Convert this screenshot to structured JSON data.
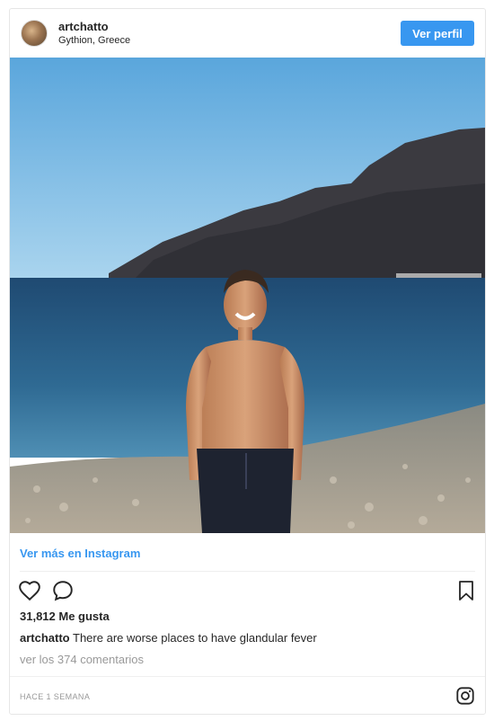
{
  "header": {
    "username": "artchatto",
    "location": "Gythion, Greece",
    "view_profile_label": "Ver perfil"
  },
  "post": {
    "image_icon": "photo-beach-shirtless-man",
    "more_link": "Ver más en Instagram",
    "likes": "31,812 Me gusta",
    "caption_user": "artchatto",
    "caption_text": "There are worse places to have glandular fever",
    "comments": "ver los 374 comentarios",
    "timestamp": "HACE 1 SEMANA"
  },
  "icons": {
    "like": "heart-icon",
    "comment": "comment-bubble-icon",
    "save": "bookmark-icon",
    "brand": "instagram-icon"
  },
  "colors": {
    "accent": "#3897f0",
    "muted": "#999999",
    "text": "#262626"
  }
}
